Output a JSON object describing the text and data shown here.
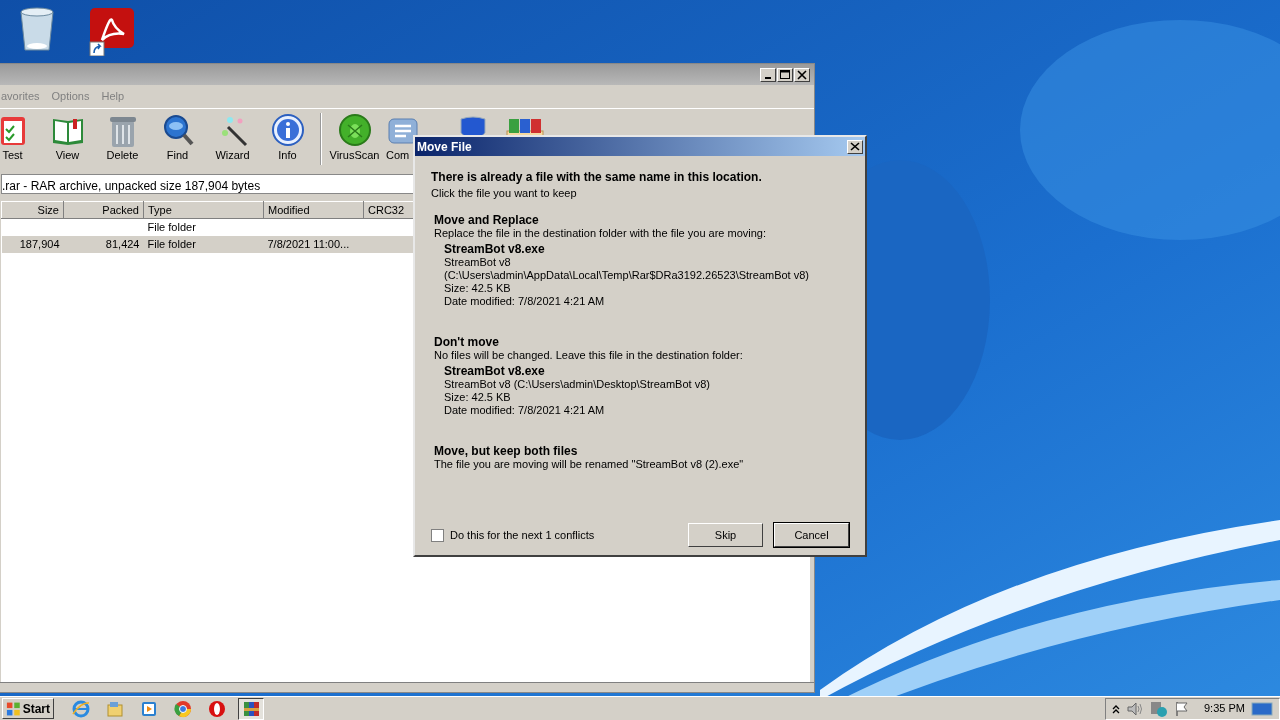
{
  "winrar": {
    "menu": [
      {
        "label": "avorites"
      },
      {
        "label": "Options"
      },
      {
        "label": "Help"
      }
    ],
    "toolbar": [
      {
        "label": "Test"
      },
      {
        "label": "View"
      },
      {
        "label": "Delete"
      },
      {
        "label": "Find"
      },
      {
        "label": "Wizard"
      },
      {
        "label": "Info"
      },
      {
        "label": "VirusScan"
      },
      {
        "label": "Com"
      }
    ],
    "address": ".rar - RAR archive, unpacked size 187,904 bytes",
    "columns": [
      "Size",
      "Packed",
      "Type",
      "Modified",
      "CRC32"
    ],
    "rows": [
      {
        "type": "File folder",
        "selected": false
      },
      {
        "size": "187,904",
        "packed": "81,424",
        "type": "File folder",
        "modified": "7/8/2021 11:00...",
        "selected": true
      }
    ]
  },
  "dialog": {
    "title": "Move File",
    "heading": "There is already a file with the same name in this location.",
    "subheading": "Click the file you want to keep",
    "options": [
      {
        "title": "Move and Replace",
        "description": "Replace the file in the destination folder with the file you are moving:",
        "file_name": "StreamBot v8.exe",
        "file_lines": [
          "StreamBot v8",
          "(C:\\Users\\admin\\AppData\\Local\\Temp\\Rar$DRa3192.26523\\StreamBot v8)",
          "Size: 42.5 KB",
          "Date modified: 7/8/2021 4:21 AM"
        ]
      },
      {
        "title": "Don't move",
        "description": "No files will be changed. Leave this file in the destination folder:",
        "file_name": "StreamBot v8.exe",
        "file_lines": [
          "StreamBot v8 (C:\\Users\\admin\\Desktop\\StreamBot v8)",
          "Size: 42.5 KB",
          "Date modified: 7/8/2021 4:21 AM"
        ]
      },
      {
        "title": "Move, but keep both files",
        "description": "The file you are moving will be renamed \"StreamBot v8 (2).exe\""
      }
    ],
    "checkbox": {
      "label": "Do this for the next 1 conflicts",
      "checked": false
    },
    "buttons": [
      {
        "label": "Skip",
        "default": false
      },
      {
        "label": "Cancel",
        "default": true
      }
    ]
  },
  "taskbar": {
    "start": "Start",
    "apps": [
      {
        "selected": false
      },
      {
        "selected": false
      },
      {
        "selected": false
      },
      {
        "selected": false
      },
      {
        "selected": false
      },
      {
        "selected": true
      }
    ],
    "clock": "9:35 PM"
  }
}
